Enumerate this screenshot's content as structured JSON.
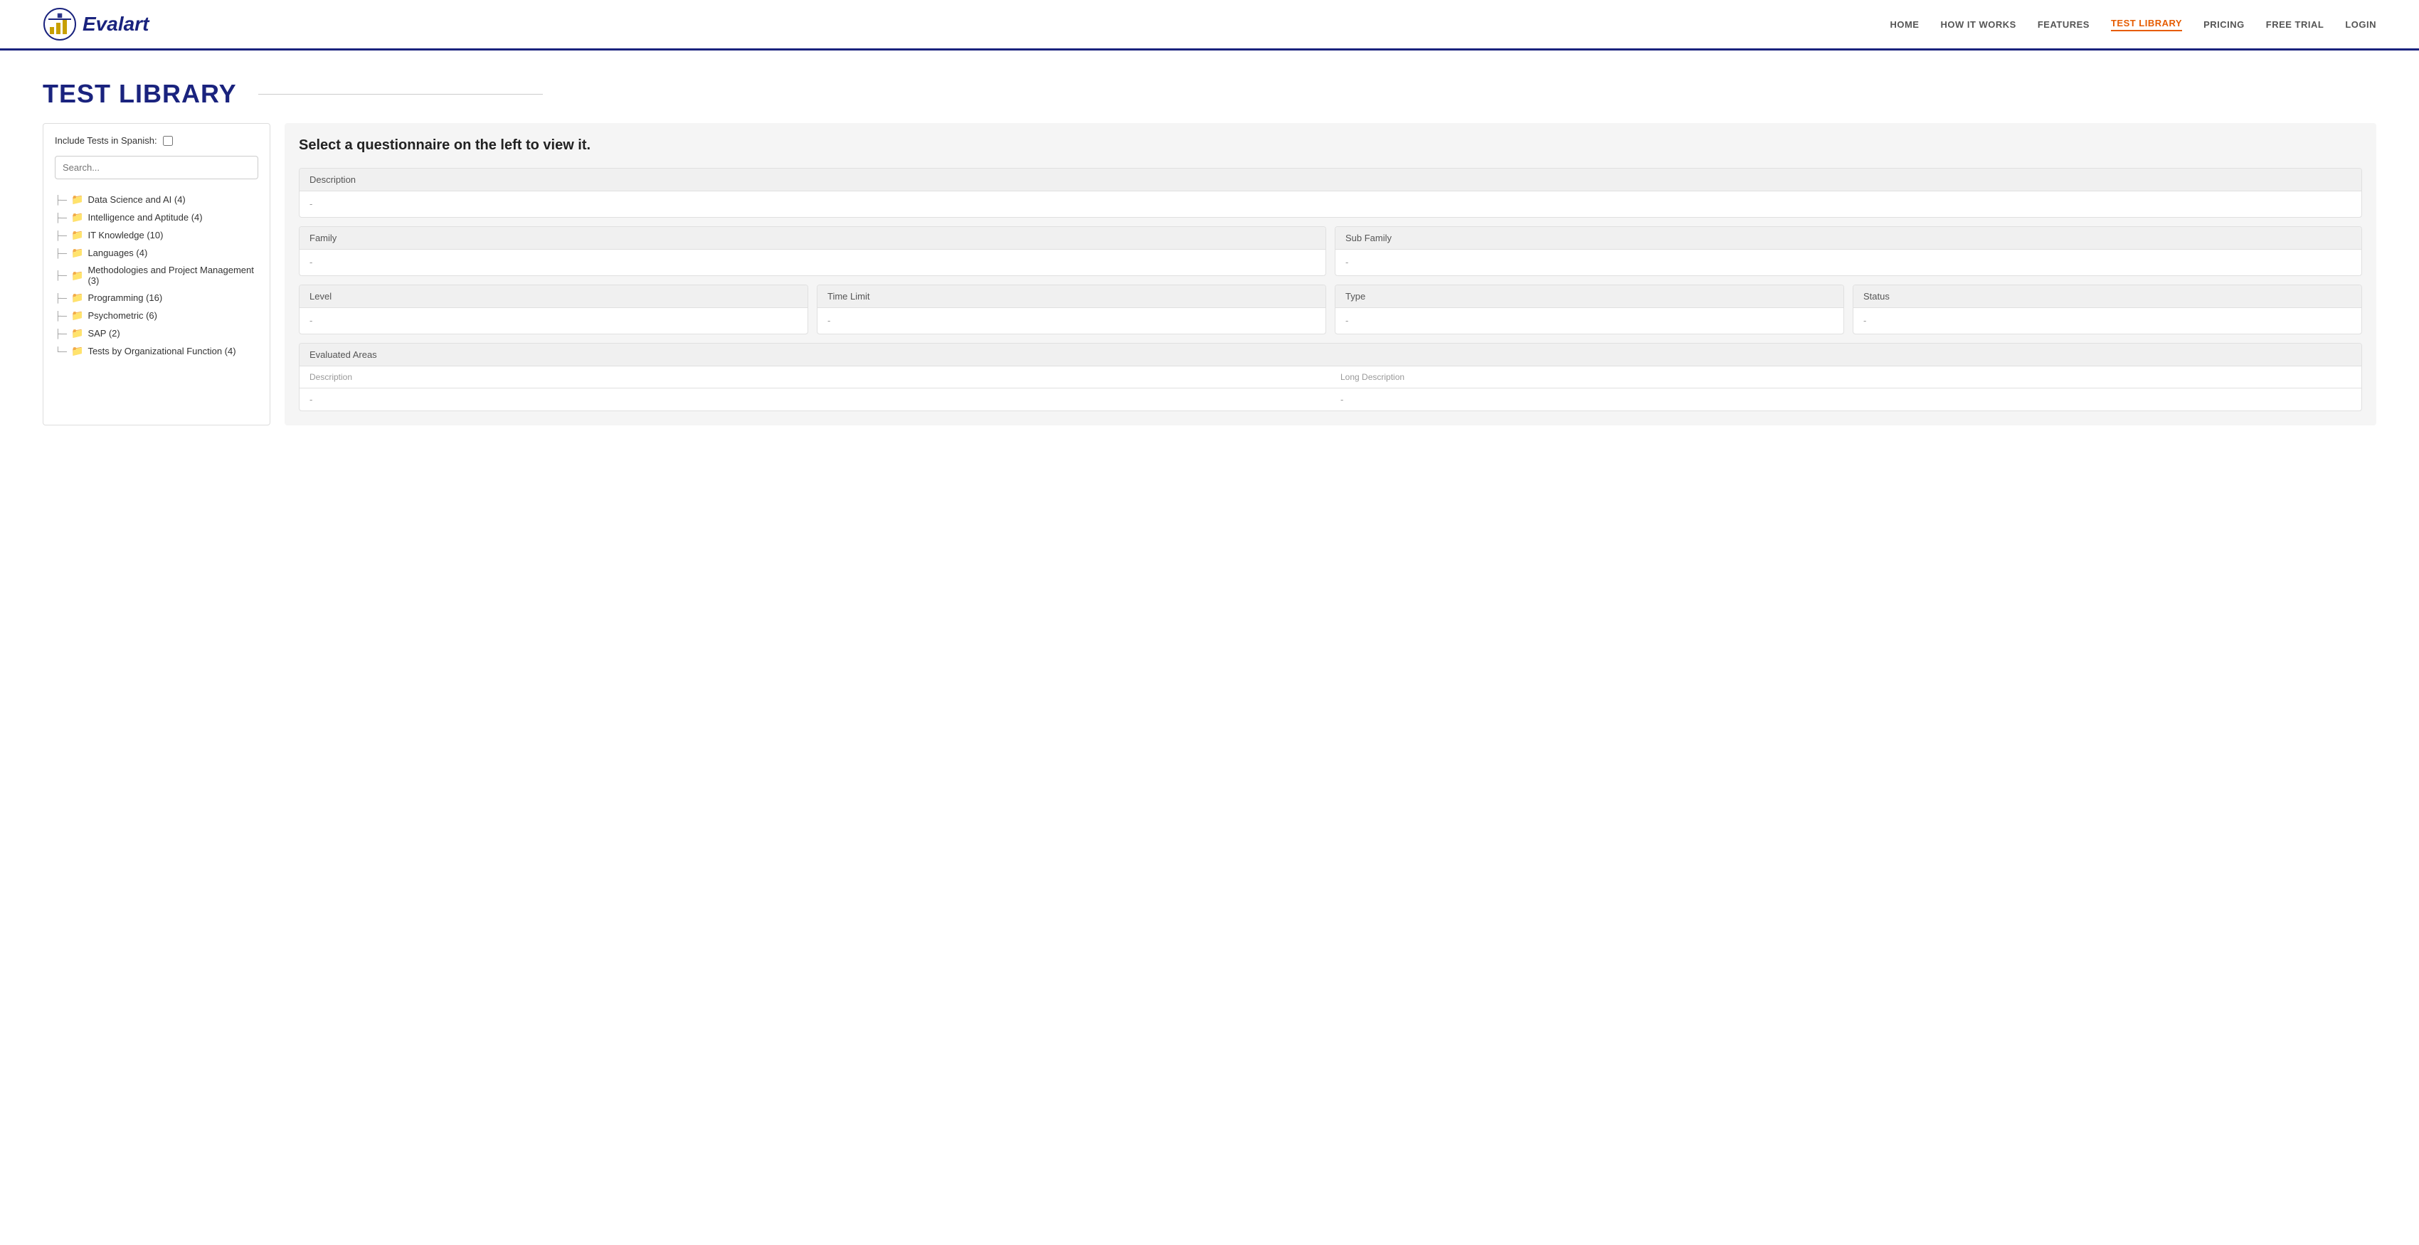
{
  "header": {
    "logo_text": "Evalart",
    "nav_items": [
      {
        "label": "HOME",
        "id": "home",
        "active": false
      },
      {
        "label": "HOW IT WORKS",
        "id": "how-it-works",
        "active": false
      },
      {
        "label": "FEATURES",
        "id": "features",
        "active": false
      },
      {
        "label": "TEST LIBRARY",
        "id": "test-library",
        "active": true
      },
      {
        "label": "PRICING",
        "id": "pricing",
        "active": false
      },
      {
        "label": "FREE TRIAL",
        "id": "free-trial",
        "active": false
      },
      {
        "label": "LOGIN",
        "id": "login",
        "active": false
      }
    ]
  },
  "page_title": "TEST LIBRARY",
  "left_panel": {
    "include_spanish_label": "Include Tests in Spanish:",
    "search_placeholder": "Search...",
    "tree_items": [
      {
        "label": "Data Science and AI (4)"
      },
      {
        "label": "Intelligence and Aptitude (4)"
      },
      {
        "label": "IT Knowledge (10)"
      },
      {
        "label": "Languages (4)"
      },
      {
        "label": "Methodologies and Project Management (3)"
      },
      {
        "label": "Programming (16)"
      },
      {
        "label": "Psychometric (6)"
      },
      {
        "label": "SAP (2)"
      },
      {
        "label": "Tests by Organizational Function (4)"
      }
    ]
  },
  "right_panel": {
    "select_message": "Select a questionnaire on the left to view it.",
    "description_label": "Description",
    "description_value": "-",
    "family_label": "Family",
    "family_value": "-",
    "sub_family_label": "Sub Family",
    "sub_family_value": "-",
    "level_label": "Level",
    "level_value": "-",
    "time_limit_label": "Time Limit",
    "time_limit_value": "-",
    "type_label": "Type",
    "type_value": "-",
    "status_label": "Status",
    "status_value": "-",
    "evaluated_areas_label": "Evaluated Areas",
    "col_description": "Description",
    "col_long_description": "Long Description",
    "area_description_value": "-",
    "area_long_description_value": "-"
  }
}
